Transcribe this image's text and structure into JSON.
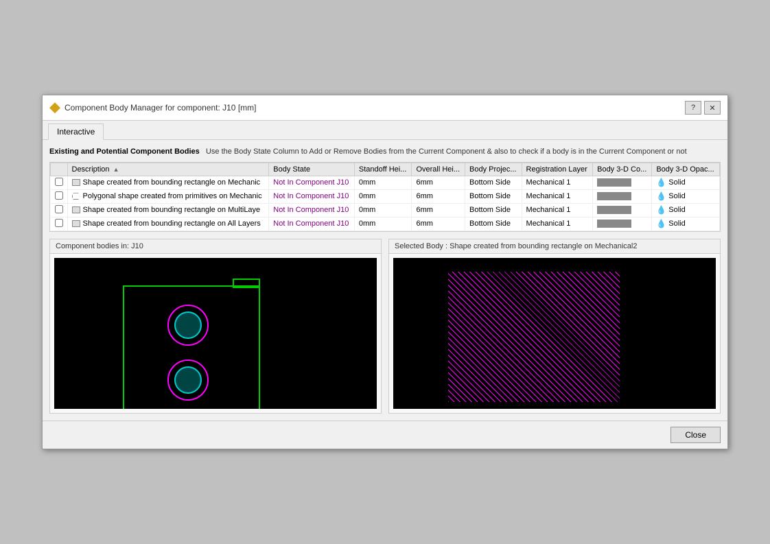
{
  "window": {
    "title": "Component Body Manager for component: J10 [mm]",
    "icon": "component-icon"
  },
  "titlebar": {
    "help_btn": "?",
    "close_btn": "✕"
  },
  "tabs": [
    {
      "label": "Interactive",
      "active": true
    }
  ],
  "section": {
    "heading": "Existing and Potential Component Bodies",
    "description": "Use the Body State Column to Add or Remove Bodies from the Current Component & also to check if a body is in the Current Component or not"
  },
  "table": {
    "columns": [
      {
        "label": "",
        "key": "check"
      },
      {
        "label": "Description",
        "key": "description",
        "sort": true
      },
      {
        "label": "Body State",
        "key": "body_state"
      },
      {
        "label": "Standoff Hei...",
        "key": "standoff"
      },
      {
        "label": "Overall Hei...",
        "key": "overall"
      },
      {
        "label": "Body Projec...",
        "key": "body_proj"
      },
      {
        "label": "Registration Layer",
        "key": "reg_layer"
      },
      {
        "label": "Body 3-D Co...",
        "key": "body_3d_color"
      },
      {
        "label": "Body 3-D Opac...",
        "key": "body_3d_opac"
      }
    ],
    "rows": [
      {
        "check": false,
        "icon": "rectangle",
        "description": "Shape created from bounding rectangle on Mechanic",
        "body_state": "Not In Component J10",
        "standoff": "0mm",
        "overall": "6mm",
        "body_proj": "Bottom Side",
        "reg_layer": "Mechanical 1",
        "body_3d_color": "#888888",
        "body_3d_opac": "Solid"
      },
      {
        "check": false,
        "icon": "polygon",
        "description": "Polygonal shape created from primitives on Mechanic",
        "body_state": "Not In Component J10",
        "standoff": "0mm",
        "overall": "6mm",
        "body_proj": "Bottom Side",
        "reg_layer": "Mechanical 1",
        "body_3d_color": "#888888",
        "body_3d_opac": "Solid"
      },
      {
        "check": false,
        "icon": "rectangle",
        "description": "Shape created from bounding rectangle on MultiLaye",
        "body_state": "Not In Component J10",
        "standoff": "0mm",
        "overall": "6mm",
        "body_proj": "Bottom Side",
        "reg_layer": "Mechanical 1",
        "body_3d_color": "#888888",
        "body_3d_opac": "Solid"
      },
      {
        "check": false,
        "icon": "rectangle",
        "description": "Shape created from bounding rectangle on All Layers",
        "body_state": "Not In Component J10",
        "standoff": "0mm",
        "overall": "6mm",
        "body_proj": "Bottom Side",
        "reg_layer": "Mechanical 1",
        "body_3d_color": "#888888",
        "body_3d_opac": "Solid"
      }
    ]
  },
  "preview_left": {
    "label": "Component bodies in: J10"
  },
  "preview_right": {
    "label": "Selected Body : Shape created from bounding rectangle on Mechanical2"
  },
  "footer": {
    "close_btn": "Close"
  }
}
